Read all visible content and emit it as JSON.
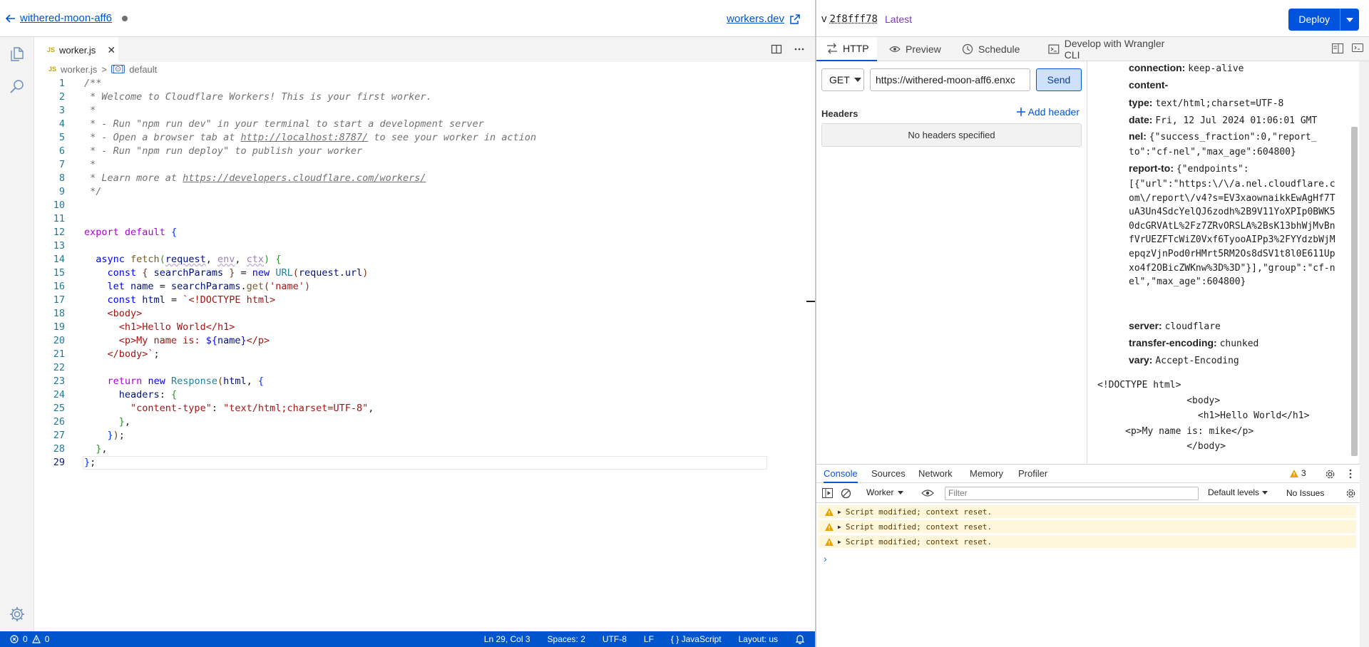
{
  "header": {
    "worker_name": "withered-moon-aff6",
    "workers_link": "workers.dev",
    "version_prefix": "v",
    "version_hash": "2f8fff78",
    "version_tag": "Latest",
    "deploy_label": "Deploy"
  },
  "editor": {
    "tab_label": "worker.js",
    "tab_badge": "JS",
    "breadcrumb_file": "worker.js",
    "breadcrumb_symbol": "default",
    "breadcrumb_separator": ">"
  },
  "status_bar": {
    "errors": "0",
    "warnings": "0",
    "position": "Ln 29, Col 3",
    "spaces": "Spaces: 2",
    "encoding": "UTF-8",
    "eol": "LF",
    "language": "JavaScript",
    "layout": "Layout: us"
  },
  "request": {
    "tabs": [
      {
        "label": "HTTP",
        "icon": "arrows-icon"
      },
      {
        "label": "Preview",
        "icon": "eye-icon"
      },
      {
        "label": "Schedule",
        "icon": "clock-icon"
      },
      {
        "label": "Develop with Wrangler CLI",
        "icon": "terminal-icon"
      }
    ],
    "method": "GET",
    "url": "https://withered-moon-aff6.enxc",
    "send_label": "Send",
    "headers_label": "Headers",
    "add_header_label": "Add header",
    "no_headers_text": "No headers specified"
  },
  "response": {
    "headers": [
      {
        "key": "connection:",
        "value": "keep-alive"
      },
      {
        "key": "content-",
        "value": ""
      },
      {
        "key": "type:",
        "value": "text/html;charset=UTF-8"
      },
      {
        "key": "date:",
        "value": "Fri, 12 Jul 2024 01:06:01 GMT"
      },
      {
        "key": "nel:",
        "value": "{\"success_fraction\":0,\"report_"
      },
      {
        "key": "",
        "value": "to\":\"cf-nel\",\"max_age\":604800}"
      },
      {
        "key": "report-to:",
        "value": "{\"endpoints\":"
      },
      {
        "key": "server:",
        "value": "cloudflare"
      },
      {
        "key": "transfer-encoding:",
        "value": "chunked"
      },
      {
        "key": "vary:",
        "value": "Accept-Encoding"
      }
    ],
    "report_to_wrapped": "[{\"url\":\"https:\\/\\/a.nel.cloudflare.com\\/report\\/v4?s=EV3xaownaikkEwAgHf7TuA3Un4SdcYelQJ6zodh%2B9V11YoXPIp0BWK50dcGRVAtL%2Fz7ZRvORSLA%2BsK13bhWjMvBnfVrUEZFTcWiZ0Vxf6TyooAIPp3%2FYYdzbWjMepqzVjnPod0rHMrt5RM2Os8dSV1t8l0E611Upxo4f2OBicZWKnw%3D%3D\"}],\"group\":\"cf-nel\",\"max_age\":604800}",
    "body": "<!DOCTYPE html>\n                <body>\n                  <h1>Hello World</h1>\n     <p>My name is: mike</p>\n                </body>"
  },
  "devtools": {
    "tabs": [
      "Console",
      "Sources",
      "Network",
      "Memory",
      "Profiler"
    ],
    "warning_count": "3",
    "context": "Worker",
    "filter_placeholder": "Filter",
    "levels": "Default levels",
    "issues": "No Issues",
    "messages": [
      "Script modified; context reset.",
      "Script modified; context reset.",
      "Script modified; context reset."
    ]
  },
  "colors": {
    "accent": "#0055dc",
    "status_bar": "#0055cc",
    "warning_bg": "#fef7dc"
  }
}
